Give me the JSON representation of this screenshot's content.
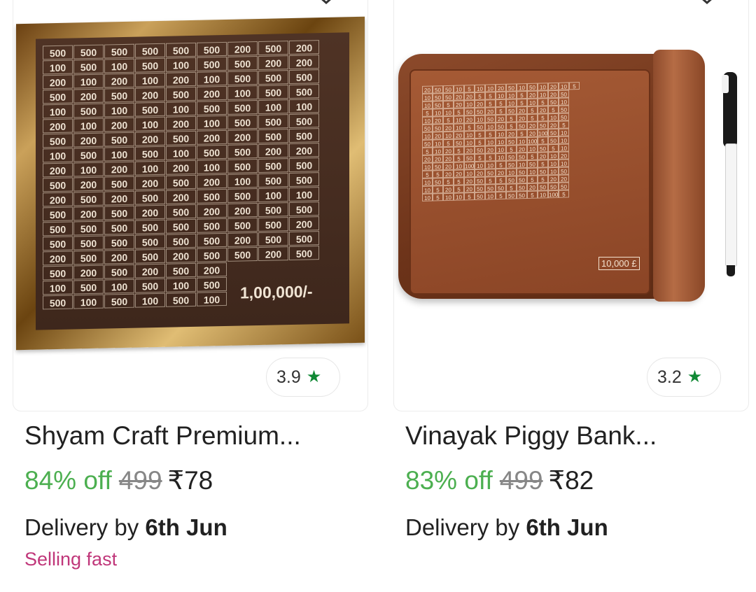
{
  "products": [
    {
      "title": "Shyam Craft Premium...",
      "rating": "3.9",
      "discount": "84% off",
      "mrp": "499",
      "price": "₹78",
      "delivery_prefix": "Delivery by",
      "delivery_date": "6th Jun",
      "badge": "Selling fast",
      "image": {
        "grid": [
          [
            "500",
            "500",
            "500",
            "500",
            "500",
            "500",
            "200",
            "500",
            "200"
          ],
          [
            "100",
            "500",
            "100",
            "500",
            "100",
            "500",
            "500",
            "200",
            "200"
          ],
          [
            "200",
            "100",
            "200",
            "100",
            "200",
            "100",
            "500",
            "500",
            "500"
          ],
          [
            "500",
            "200",
            "500",
            "200",
            "500",
            "200",
            "100",
            "500",
            "500"
          ],
          [
            "100",
            "500",
            "100",
            "500",
            "100",
            "500",
            "500",
            "100",
            "100"
          ],
          [
            "200",
            "100",
            "200",
            "100",
            "200",
            "100",
            "500",
            "500",
            "500"
          ],
          [
            "500",
            "200",
            "500",
            "200",
            "500",
            "200",
            "200",
            "500",
            "500"
          ],
          [
            "100",
            "500",
            "100",
            "500",
            "100",
            "500",
            "500",
            "200",
            "200"
          ],
          [
            "200",
            "100",
            "200",
            "100",
            "200",
            "100",
            "500",
            "500",
            "500"
          ],
          [
            "500",
            "200",
            "500",
            "200",
            "500",
            "200",
            "100",
            "500",
            "500"
          ],
          [
            "200",
            "500",
            "200",
            "500",
            "200",
            "500",
            "500",
            "100",
            "100"
          ],
          [
            "500",
            "200",
            "500",
            "200",
            "500",
            "200",
            "200",
            "500",
            "500"
          ],
          [
            "500",
            "500",
            "500",
            "500",
            "500",
            "500",
            "500",
            "500",
            "200"
          ],
          [
            "500",
            "500",
            "500",
            "500",
            "500",
            "500",
            "200",
            "500",
            "500"
          ],
          [
            "200",
            "500",
            "200",
            "500",
            "200",
            "500",
            "500",
            "200",
            "500"
          ],
          [
            "500",
            "200",
            "500",
            "200",
            "500",
            "200",
            "",
            "",
            ""
          ],
          [
            "100",
            "500",
            "100",
            "500",
            "100",
            "500",
            "",
            "",
            ""
          ],
          [
            "500",
            "100",
            "500",
            "100",
            "500",
            "100",
            "",
            "",
            ""
          ]
        ],
        "total_text": "1,00,000/-"
      }
    },
    {
      "title": "Vinayak Piggy Bank...",
      "rating": "3.2",
      "discount": "83% off",
      "mrp": "499",
      "price": "₹82",
      "delivery_prefix": "Delivery by",
      "delivery_date": "6th Jun",
      "image": {
        "grid": [
          [
            "20",
            "50",
            "50",
            "10",
            "5",
            "10",
            "10",
            "20",
            "50",
            "10",
            "50",
            "10",
            "20",
            "10",
            "5",
            "",
            "",
            "",
            "",
            ""
          ],
          [
            "10",
            "50",
            "50",
            "20",
            "20",
            "5",
            "5",
            "10",
            "10",
            "5",
            "20",
            "10",
            "20",
            "50",
            "",
            "",
            "",
            "",
            "",
            ""
          ],
          [
            "10",
            "50",
            "5",
            "20",
            "10",
            "20",
            "5",
            "5",
            "10",
            "5",
            "10",
            "5",
            "50",
            "10",
            "",
            "",
            "",
            "",
            "",
            ""
          ],
          [
            "5",
            "10",
            "10",
            "5",
            "50",
            "50",
            "20",
            "5",
            "50",
            "20",
            "5",
            "20",
            "5",
            "50",
            "",
            "",
            "",
            "",
            "",
            ""
          ],
          [
            "10",
            "20",
            "5",
            "10",
            "20",
            "10",
            "50",
            "20",
            "5",
            "20",
            "5",
            "5",
            "10",
            "50",
            "",
            "",
            "",
            "",
            "",
            ""
          ],
          [
            "50",
            "50",
            "20",
            "10",
            "5",
            "50",
            "10",
            "50",
            "5",
            "50",
            "20",
            "50",
            "20",
            "5",
            "",
            "",
            "",
            "",
            "",
            ""
          ],
          [
            "10",
            "20",
            "10",
            "20",
            "10",
            "5",
            "5",
            "10",
            "20",
            "5",
            "20",
            "100",
            "50",
            "10",
            "",
            "",
            "",
            "",
            "",
            ""
          ],
          [
            "50",
            "10",
            "5",
            "50",
            "10",
            "5",
            "10",
            "10",
            "50",
            "10",
            "100",
            "5",
            "50",
            "10",
            "",
            "",
            "",
            "",
            "",
            ""
          ],
          [
            "5",
            "10",
            "20",
            "5",
            "20",
            "50",
            "20",
            "10",
            "5",
            "20",
            "10",
            "50",
            "5",
            "10",
            "",
            "",
            "",
            "",
            "",
            ""
          ],
          [
            "20",
            "20",
            "20",
            "5",
            "50",
            "5",
            "5",
            "10",
            "50",
            "50",
            "5",
            "20",
            "10",
            "20",
            "",
            "",
            "",
            "",
            "",
            ""
          ],
          [
            "10",
            "50",
            "20",
            "10",
            "100",
            "10",
            "10",
            "5",
            "50",
            "10",
            "50",
            "5",
            "10",
            "10",
            "",
            "",
            "",
            "",
            "",
            ""
          ],
          [
            "5",
            "5",
            "20",
            "20",
            "10",
            "20",
            "50",
            "20",
            "10",
            "50",
            "10",
            "50",
            "10",
            "50",
            "",
            "",
            "",
            "",
            "",
            ""
          ],
          [
            "10",
            "50",
            "5",
            "5",
            "20",
            "50",
            "5",
            "5",
            "50",
            "50",
            "5",
            "5",
            "20",
            "20",
            "",
            "",
            "",
            "",
            "",
            ""
          ],
          [
            "10",
            "5",
            "20",
            "5",
            "20",
            "50",
            "50",
            "50",
            "5",
            "50",
            "20",
            "50",
            "50",
            "50",
            "",
            "",
            "",
            "",
            "",
            ""
          ],
          [
            "10",
            "5",
            "10",
            "10",
            "5",
            "50",
            "10",
            "5",
            "50",
            "50",
            "5",
            "10",
            "100",
            "5",
            "",
            "",
            "",
            "",
            "",
            ""
          ]
        ],
        "total_text": "10,000 £"
      }
    }
  ]
}
